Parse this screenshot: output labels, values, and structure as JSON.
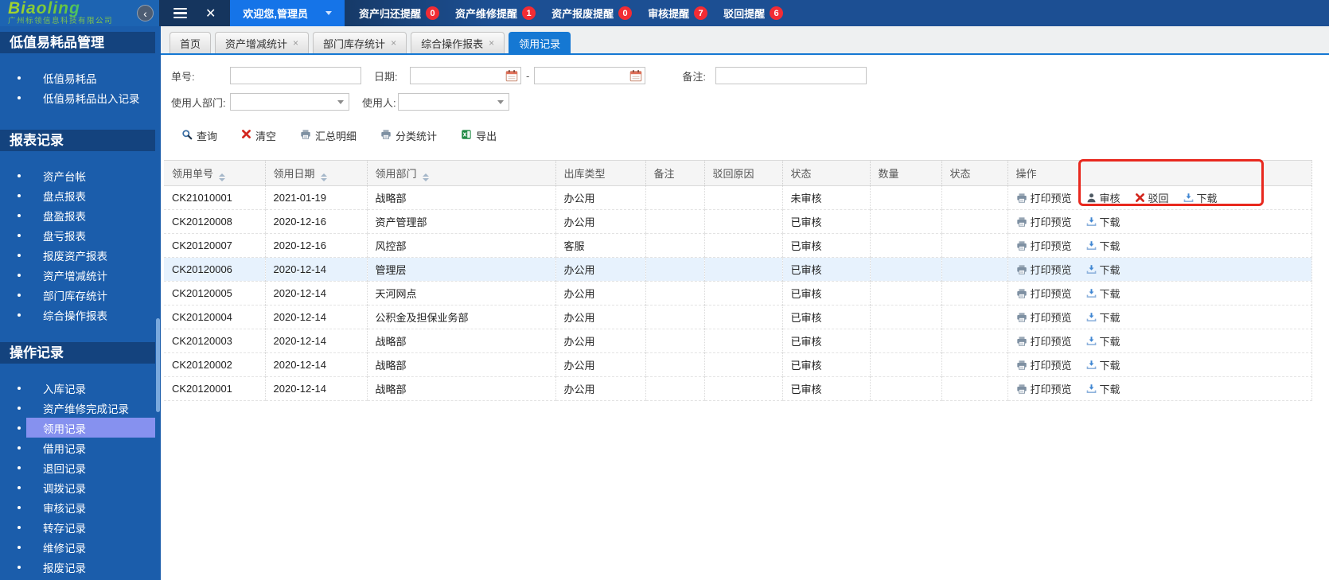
{
  "topbar": {
    "logo": {
      "brand": "Biaoling",
      "company": "广州标领信息科技有限公司"
    },
    "welcome": {
      "label": "欢迎您,管理员"
    },
    "notifications": [
      {
        "label": "资产归还提醒",
        "count": "0"
      },
      {
        "label": "资产维修提醒",
        "count": "1"
      },
      {
        "label": "资产报废提醒",
        "count": "0"
      },
      {
        "label": "审核提醒",
        "count": "7"
      },
      {
        "label": "驳回提醒",
        "count": "6"
      }
    ]
  },
  "icons": {
    "tab_close": "×",
    "close_all": "✕",
    "collapse": "‹"
  },
  "sidebar": {
    "sections": [
      {
        "title": "低值易耗品管理",
        "items": [
          {
            "label": "低值易耗品"
          },
          {
            "label": "低值易耗品出入记录"
          }
        ]
      },
      {
        "title": "报表记录",
        "items": [
          {
            "label": "资产台帐"
          },
          {
            "label": "盘点报表"
          },
          {
            "label": "盘盈报表"
          },
          {
            "label": "盘亏报表"
          },
          {
            "label": "报废资产报表"
          },
          {
            "label": "资产增减统计"
          },
          {
            "label": "部门库存统计"
          },
          {
            "label": "综合操作报表"
          }
        ]
      },
      {
        "title": "操作记录",
        "items": [
          {
            "label": "入库记录"
          },
          {
            "label": "资产维修完成记录"
          },
          {
            "label": "领用记录",
            "active": true
          },
          {
            "label": "借用记录"
          },
          {
            "label": "退回记录"
          },
          {
            "label": "调拨记录"
          },
          {
            "label": "审核记录"
          },
          {
            "label": "转存记录"
          },
          {
            "label": "维修记录"
          },
          {
            "label": "报废记录"
          }
        ]
      }
    ]
  },
  "tabs": [
    {
      "label": "首页"
    },
    {
      "label": "资产增减统计",
      "closable": true
    },
    {
      "label": "部门库存统计",
      "closable": true
    },
    {
      "label": "综合操作报表",
      "closable": true
    },
    {
      "label": "领用记录",
      "active": true
    }
  ],
  "filters": {
    "order_no_label": "单号:",
    "order_no_value": "",
    "date_label": "日期:",
    "date_from_value": "",
    "date_separator": "-",
    "date_to_value": "",
    "remark_label": "备注:",
    "remark_value": "",
    "user_dept_label": "使用人部门:",
    "user_dept_value": "",
    "user_label": "使用人:",
    "user_value": ""
  },
  "toolbar": {
    "query": "查询",
    "clear": "清空",
    "summary_detail": "汇总明细",
    "category_stats": "分类统计",
    "export": "导出"
  },
  "table": {
    "columns": [
      {
        "label": "领用单号",
        "sortable": true
      },
      {
        "label": "领用日期",
        "sortable": true
      },
      {
        "label": "领用部门",
        "sortable": true
      },
      {
        "label": "出库类型"
      },
      {
        "label": "备注"
      },
      {
        "label": "驳回原因"
      },
      {
        "label": "状态"
      },
      {
        "label": "数量"
      },
      {
        "label": "状态"
      },
      {
        "label": "操作"
      }
    ],
    "action_labels": {
      "print": "打印预览",
      "audit": "审核",
      "reject": "驳回",
      "download": "下载"
    },
    "rows": [
      {
        "order_no": "CK21010001",
        "date": "2021-01-19",
        "dept": "战略部",
        "out_type": "办公用",
        "remark": "",
        "reject_reason": "",
        "status": "未审核",
        "qty": "",
        "status2": "",
        "actions": [
          "print",
          "audit",
          "reject",
          "download"
        ]
      },
      {
        "order_no": "CK20120008",
        "date": "2020-12-16",
        "dept": "资产管理部",
        "out_type": "办公用",
        "remark": "",
        "reject_reason": "",
        "status": "已审核",
        "qty": "",
        "status2": "",
        "actions": [
          "print",
          "download"
        ]
      },
      {
        "order_no": "CK20120007",
        "date": "2020-12-16",
        "dept": "风控部",
        "out_type": "客服",
        "remark": "",
        "reject_reason": "",
        "status": "已审核",
        "qty": "",
        "status2": "",
        "actions": [
          "print",
          "download"
        ]
      },
      {
        "order_no": "CK20120006",
        "date": "2020-12-14",
        "dept": "管理层",
        "out_type": "办公用",
        "remark": "",
        "reject_reason": "",
        "status": "已审核",
        "qty": "",
        "status2": "",
        "actions": [
          "print",
          "download"
        ],
        "highlighted": true
      },
      {
        "order_no": "CK20120005",
        "date": "2020-12-14",
        "dept": "天河网点",
        "out_type": "办公用",
        "remark": "",
        "reject_reason": "",
        "status": "已审核",
        "qty": "",
        "status2": "",
        "actions": [
          "print",
          "download"
        ]
      },
      {
        "order_no": "CK20120004",
        "date": "2020-12-14",
        "dept": "公积金及担保业务部",
        "out_type": "办公用",
        "remark": "",
        "reject_reason": "",
        "status": "已审核",
        "qty": "",
        "status2": "",
        "actions": [
          "print",
          "download"
        ]
      },
      {
        "order_no": "CK20120003",
        "date": "2020-12-14",
        "dept": "战略部",
        "out_type": "办公用",
        "remark": "",
        "reject_reason": "",
        "status": "已审核",
        "qty": "",
        "status2": "",
        "actions": [
          "print",
          "download"
        ]
      },
      {
        "order_no": "CK20120002",
        "date": "2020-12-14",
        "dept": "战略部",
        "out_type": "办公用",
        "remark": "",
        "reject_reason": "",
        "status": "已审核",
        "qty": "",
        "status2": "",
        "actions": [
          "print",
          "download"
        ]
      },
      {
        "order_no": "CK20120001",
        "date": "2020-12-14",
        "dept": "战略部",
        "out_type": "办公用",
        "remark": "",
        "reject_reason": "",
        "status": "已审核",
        "qty": "",
        "status2": "",
        "actions": [
          "print",
          "download"
        ]
      }
    ]
  },
  "colors": {
    "topbar_blue": "#1b5dab",
    "topbar_dark": "#15355e",
    "accent_blue": "#1578d3",
    "welcome_blue": "#1574e8",
    "badge_red": "#f22c34",
    "sidebar_section_bg": "#14437e",
    "selected_item_bg": "#8691ef",
    "row_highlight": "#e7f2fd",
    "annotation_red": "#e8281e"
  }
}
